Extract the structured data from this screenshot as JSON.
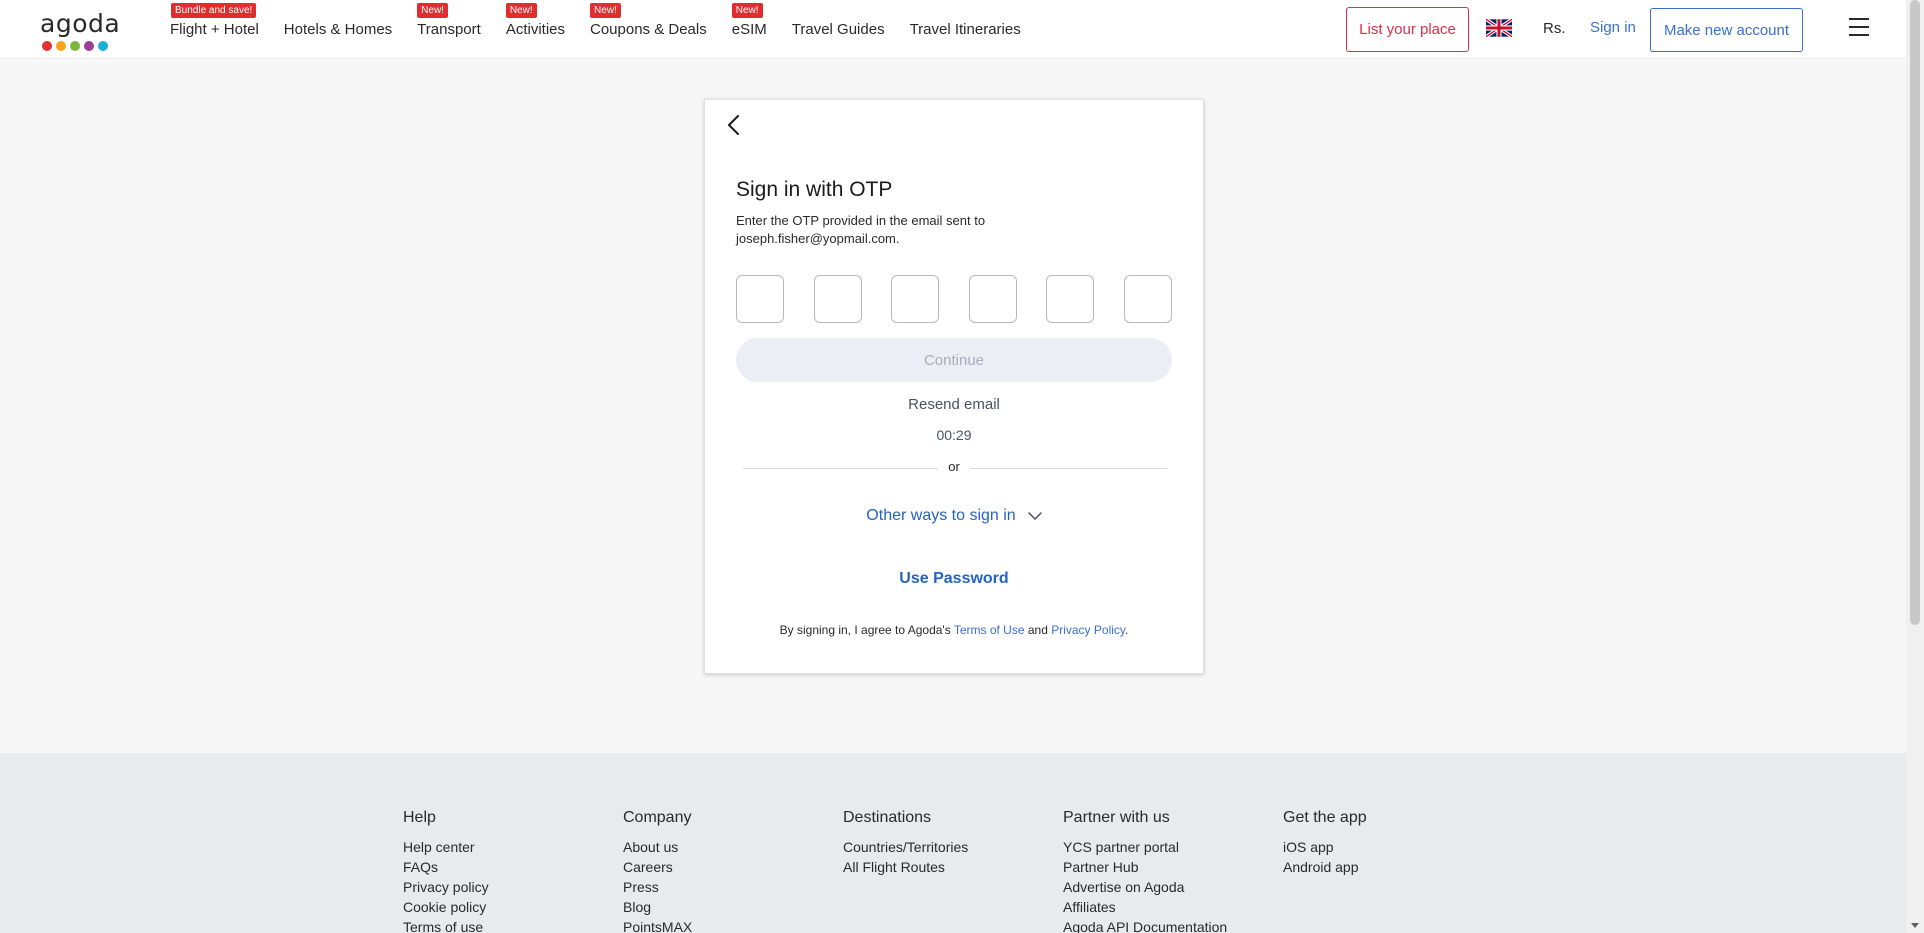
{
  "header": {
    "logo_text": "agoda",
    "logo_colors": [
      "#e2312f",
      "#f4a51b",
      "#7bb73f",
      "#9b3d96",
      "#1bb0d9"
    ],
    "nav": [
      {
        "label": "Flight + Hotel",
        "badge": "Bundle and save!"
      },
      {
        "label": "Hotels & Homes",
        "badge": ""
      },
      {
        "label": "Transport",
        "badge": "New!"
      },
      {
        "label": "Activities",
        "badge": "New!"
      },
      {
        "label": "Coupons & Deals",
        "badge": "New!"
      },
      {
        "label": "eSIM",
        "badge": "New!"
      },
      {
        "label": "Travel Guides",
        "badge": ""
      },
      {
        "label": "Travel Itineraries",
        "badge": ""
      }
    ],
    "list_place": "List your place",
    "currency": "Rs.",
    "sign_in": "Sign in",
    "make_account": "Make new account"
  },
  "card": {
    "title": "Sign in with OTP",
    "description": "Enter the OTP provided in the email sent to joseph.fisher@yopmail.com.",
    "otp_values": [
      "",
      "",
      "",
      "",
      "",
      ""
    ],
    "continue_label": "Continue",
    "resend_label": "Resend email",
    "timer": "00:29",
    "or_label": "or",
    "other_ways_label": "Other ways to sign in",
    "use_password_label": "Use Password",
    "terms_prefix": "By signing in, I agree to Agoda's ",
    "terms_of_use": "Terms of Use",
    "terms_and": " and ",
    "privacy_policy": "Privacy Policy",
    "terms_suffix": "."
  },
  "footer": {
    "columns": [
      {
        "heading": "Help",
        "links": [
          "Help center",
          "FAQs",
          "Privacy policy",
          "Cookie policy",
          "Terms of use"
        ]
      },
      {
        "heading": "Company",
        "links": [
          "About us",
          "Careers",
          "Press",
          "Blog",
          "PointsMAX"
        ]
      },
      {
        "heading": "Destinations",
        "links": [
          "Countries/Territories",
          "All Flight Routes"
        ]
      },
      {
        "heading": "Partner with us",
        "links": [
          "YCS partner portal",
          "Partner Hub",
          "Advertise on Agoda",
          "Affiliates",
          "Agoda API Documentation"
        ]
      },
      {
        "heading": "Get the app",
        "links": [
          "iOS app",
          "Android app"
        ]
      }
    ]
  }
}
